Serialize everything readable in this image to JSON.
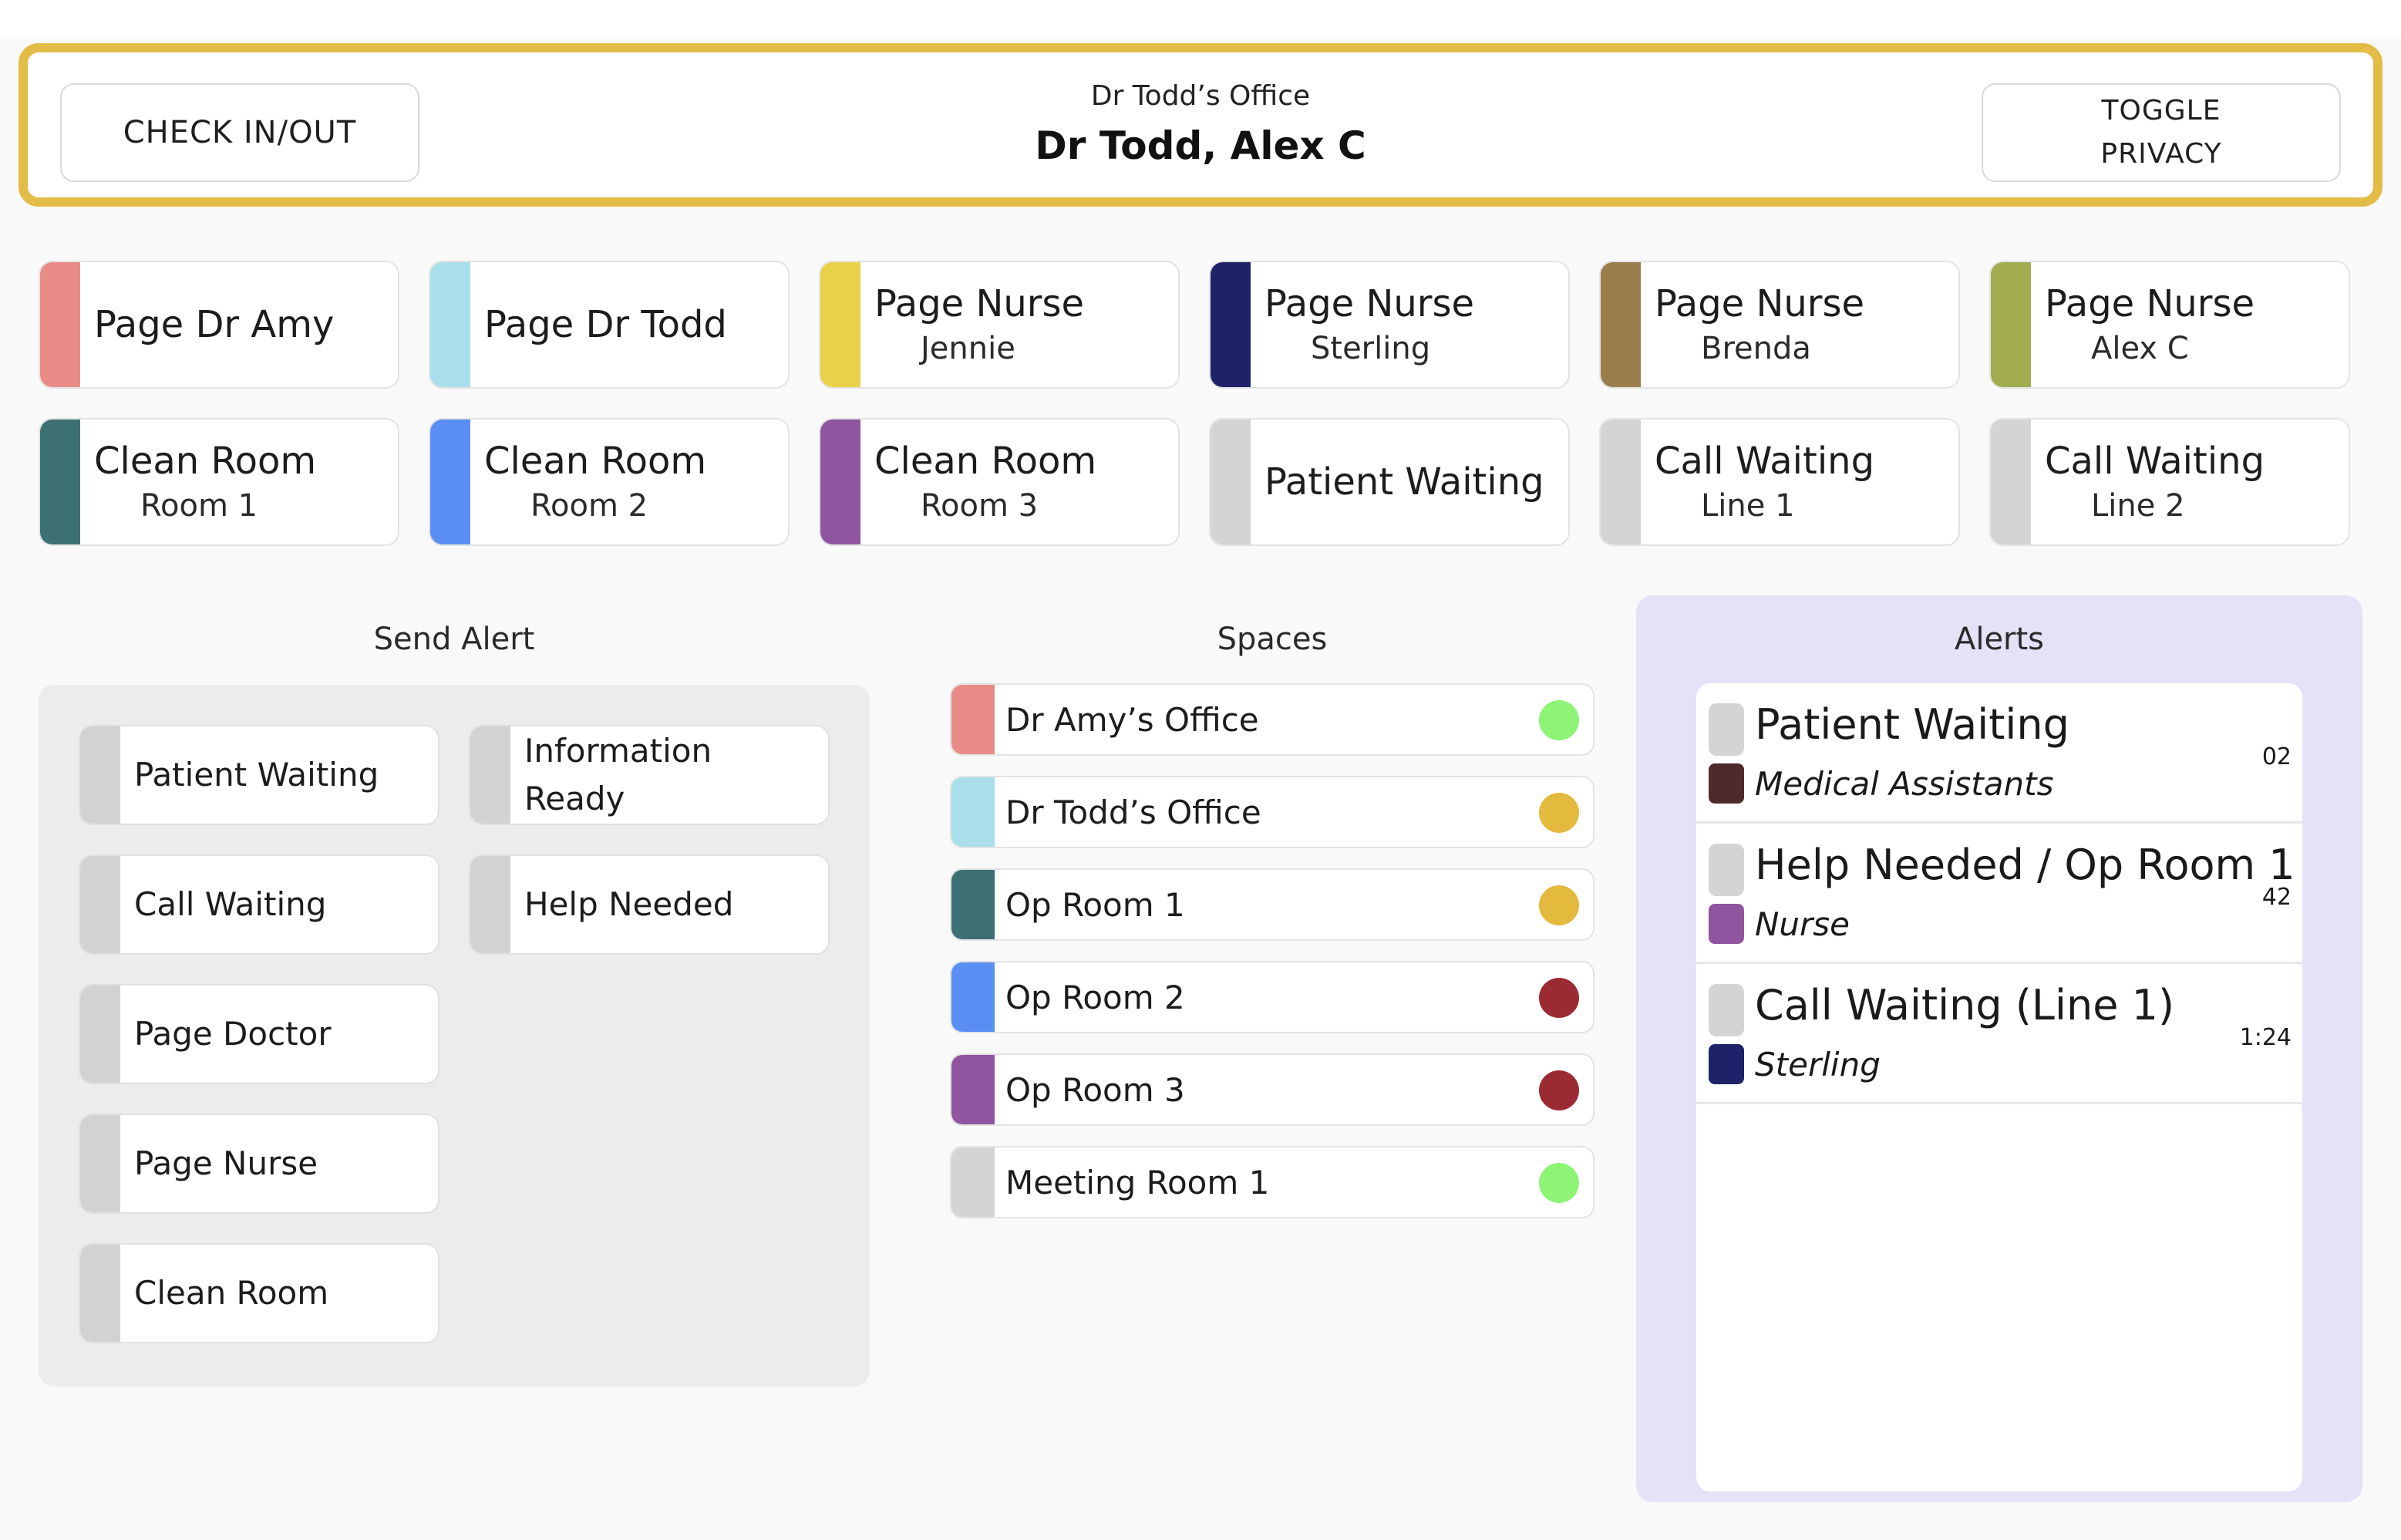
{
  "header": {
    "check_label": "CHECK IN/OUT",
    "office": "Dr Todd’s Office",
    "user": "Dr Todd, Alex C",
    "privacy_label": "TOGGLE PRIVACY",
    "accent_color": "#e3bc47"
  },
  "quick_actions": [
    {
      "line1": "Page Dr Amy",
      "line2": "",
      "color": "#e98c89"
    },
    {
      "line1": "Page Dr Todd",
      "line2": "",
      "color": "#a8dfea"
    },
    {
      "line1": "Page Nurse",
      "line2": "Jennie",
      "color": "#e7d24a"
    },
    {
      "line1": "Page Nurse",
      "line2": "Sterling",
      "color": "#1d2269"
    },
    {
      "line1": "Page Nurse",
      "line2": "Brenda",
      "color": "#9b7e4d"
    },
    {
      "line1": "Page Nurse",
      "line2": "Alex C",
      "color": "#a2ad4f"
    },
    {
      "line1": "Clean Room",
      "line2": "Room 1",
      "color": "#3d7074"
    },
    {
      "line1": "Clean Room",
      "line2": "Room 2",
      "color": "#5b8ef3"
    },
    {
      "line1": "Clean Room",
      "line2": "Room 3",
      "color": "#8f559e"
    },
    {
      "line1": "Patient Waiting",
      "line2": "",
      "color": "#d4d4d4"
    },
    {
      "line1": "Call Waiting",
      "line2": "Line 1",
      "color": "#d4d4d4"
    },
    {
      "line1": "Call Waiting",
      "line2": "Line 2",
      "color": "#d4d4d4"
    }
  ],
  "send_alert": {
    "title": "Send Alert",
    "buttons": [
      "Patient Waiting",
      "Information Ready",
      "Call Waiting",
      "Help Needed",
      "Page Doctor",
      "Page Nurse",
      "Clean Room"
    ]
  },
  "spaces": {
    "title": "Spaces",
    "items": [
      {
        "label": "Dr Amy’s Office",
        "color": "#e98c89",
        "status": "#8df475"
      },
      {
        "label": "Dr Todd’s Office",
        "color": "#a8dfea",
        "status": "#e3b93e"
      },
      {
        "label": "Op Room 1",
        "color": "#3d7074",
        "status": "#e3b93e"
      },
      {
        "label": "Op Room 2",
        "color": "#5b8ef3",
        "status": "#9b2a33"
      },
      {
        "label": "Op Room 3",
        "color": "#8f559e",
        "status": "#9b2a33"
      },
      {
        "label": "Meeting Room 1",
        "color": "#d4d4d4",
        "status": "#8df475"
      }
    ]
  },
  "alerts": {
    "title": "Alerts",
    "items": [
      {
        "title": "Patient Waiting",
        "who": "Medical Assistants",
        "time": "02",
        "color": "#4f2a2c"
      },
      {
        "title": "Help Needed / Op Room 1",
        "who": "Nurse",
        "time": "42",
        "color": "#8f559e"
      },
      {
        "title": "Call Waiting (Line 1)",
        "who": "Sterling",
        "time": "1:24",
        "color": "#1d2269"
      }
    ]
  }
}
